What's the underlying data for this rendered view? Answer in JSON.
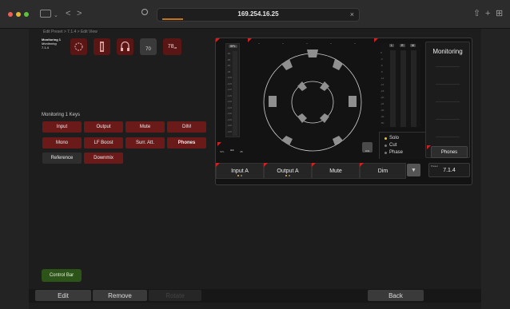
{
  "browser": {
    "url": "169.254.16.25",
    "sidebar_icon": "sidebar-icon",
    "back_icon": "<",
    "forward_icon": ">",
    "shield_icon": "shield-icon",
    "close_tab": "×",
    "share_icon": "⇧",
    "new_tab": "+",
    "tabs_overview": "⊞"
  },
  "app": {
    "breadcrumb": "Edit Preset > 7.1.4 > Edit View",
    "preset_block": {
      "line1": "Monitoring 1",
      "line2": "Monitoring",
      "line3": "7.1.4"
    },
    "icons": [
      {
        "name": "monitoring-speaker-icon",
        "label": "",
        "color": "#5a1515"
      },
      {
        "name": "talkback-icon",
        "label": "",
        "color": "#5a1515"
      },
      {
        "name": "phones-icon",
        "label": "",
        "color": "#5a1515"
      },
      {
        "name": "level-70-icon",
        "label": "70",
        "color": "#3a3a3a"
      },
      {
        "name": "level-78-icon",
        "label": "78",
        "color": "#5a1515"
      }
    ],
    "keys_title": "Monitoring 1 Keys",
    "keys": [
      {
        "label": "Input",
        "style": "red"
      },
      {
        "label": "Output",
        "style": "red"
      },
      {
        "label": "Mute",
        "style": "red"
      },
      {
        "label": "DIM",
        "style": "red"
      },
      {
        "label": "Mono",
        "style": "red"
      },
      {
        "label": "LF Boost",
        "style": "red"
      },
      {
        "label": "Surr. Att.",
        "style": "red"
      },
      {
        "label": "Phones",
        "style": "red-bold"
      },
      {
        "label": "Reference",
        "style": "dark"
      },
      {
        "label": "Downmix",
        "style": "red"
      }
    ],
    "control_bar": "Control Bar",
    "footer": {
      "edit": "Edit",
      "remove": "Remove",
      "rotate": "Rotate",
      "back": "Back"
    }
  },
  "panel": {
    "spl_label": "SPL",
    "spl_ticks": [
      "-80",
      "-85",
      "-90",
      "-95",
      "-100",
      "-105",
      "-110",
      "-115",
      "-120",
      "-125",
      "-130",
      "-135",
      "-140",
      "-145"
    ],
    "spl_readout": "--",
    "spl_unit": "dB",
    "spl_mode": "SPL",
    "meter_labels": [
      "L",
      "R",
      "M"
    ],
    "meter_ticks": [
      "0",
      "-3",
      "-6",
      "-9",
      "-12",
      "-15",
      "-18",
      "-20",
      "-24",
      "-30",
      "-40",
      "-50"
    ],
    "lfe_label": "LFE",
    "solo_options": [
      {
        "label": "Solo",
        "active": true
      },
      {
        "label": "Cut",
        "active": false
      },
      {
        "label": "Phase",
        "active": false
      }
    ],
    "monitoring_title": "Monitoring",
    "phones_label": "Phones",
    "preset_label": "Preset",
    "preset_value": "7.1.4",
    "bottom_buttons": [
      "Input A",
      "Output A",
      "Mute",
      "Dim"
    ],
    "accent_red": "#d02020",
    "solo_dot_color": "#e8c23a"
  }
}
